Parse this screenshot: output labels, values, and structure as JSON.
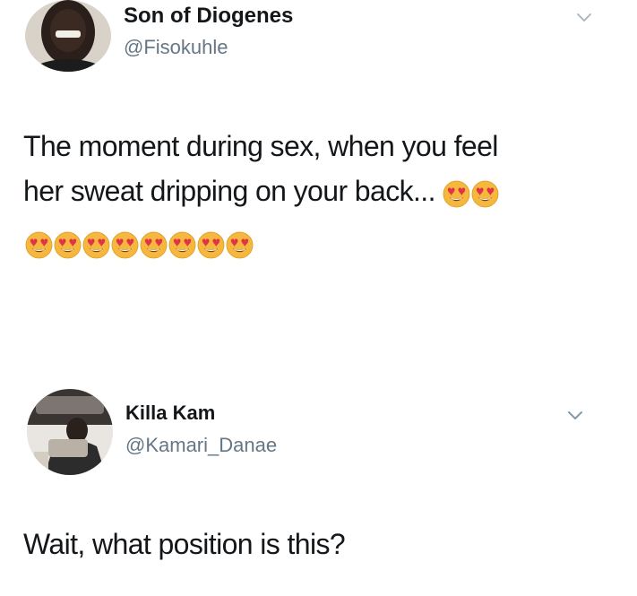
{
  "tweets": [
    {
      "display_name": "Son of Diogenes",
      "handle": "@Fisokuhle",
      "text_line1": "The moment during sex, when you feel",
      "text_line2": "her sweat dripping on your back...",
      "emoji_name": "heart-eyes-emoji",
      "emoji_count_inline": 2,
      "emoji_count_row": 8,
      "menu_icon": "chevron-down-icon"
    },
    {
      "display_name": "Killa Kam",
      "handle": "@Kamari_Danae",
      "text": "Wait, what position is this?",
      "menu_icon": "chevron-down-icon"
    }
  ],
  "colors": {
    "name": "#14171a",
    "handle": "#657786",
    "chevron": "#8899a6",
    "emoji_face": "#f5b83d"
  }
}
